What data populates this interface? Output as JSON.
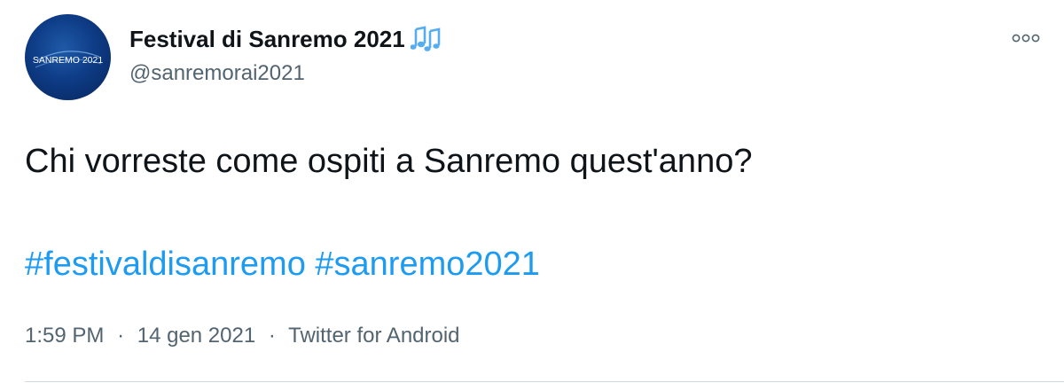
{
  "tweet": {
    "author": {
      "display_name": "Festival di Sanremo 2021",
      "name_emoji_icon": "musical-notes-icon",
      "handle": "@sanremorai2021",
      "avatar_text": "SANREMO 2021",
      "avatar_icon": "sanremo-logo"
    },
    "text": "Chi vorreste come ospiti a Sanremo quest'anno?",
    "hashtags": [
      "#festivaldisanremo",
      "#sanremo2021"
    ],
    "meta": {
      "time": "1:59 PM",
      "date": "14 gen 2021",
      "separator": "·",
      "source": "Twitter for Android"
    },
    "more_icon": "more-options-icon"
  },
  "colors": {
    "text": "#0f1419",
    "secondary": "#536471",
    "link": "#1d9bf0",
    "avatar_bg": "#0e3c86",
    "music_emoji": "#55acee"
  }
}
